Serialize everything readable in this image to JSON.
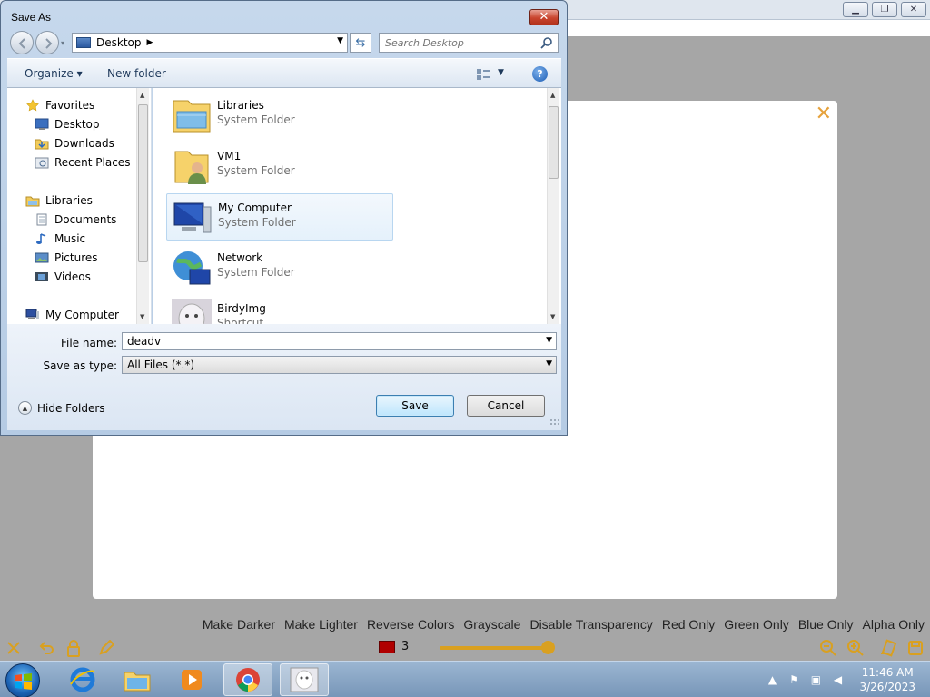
{
  "dialog": {
    "title": "Save As",
    "close_label": "✕",
    "address": "Desktop",
    "search_placeholder": "Search Desktop",
    "toolbar": {
      "organize": "Organize ▾",
      "new_folder": "New folder"
    },
    "nav": {
      "items": [
        {
          "label": "Favorites",
          "icon": "star-icon",
          "kind": "group"
        },
        {
          "label": "Desktop",
          "icon": "desktop-icon",
          "kind": "child"
        },
        {
          "label": "Downloads",
          "icon": "downloads-icon",
          "kind": "child"
        },
        {
          "label": "Recent Places",
          "icon": "recent-places-icon",
          "kind": "child"
        },
        {
          "label": "Libraries",
          "icon": "libraries-icon",
          "kind": "group"
        },
        {
          "label": "Documents",
          "icon": "documents-icon",
          "kind": "child"
        },
        {
          "label": "Music",
          "icon": "music-icon",
          "kind": "child"
        },
        {
          "label": "Pictures",
          "icon": "pictures-icon",
          "kind": "child"
        },
        {
          "label": "Videos",
          "icon": "videos-icon",
          "kind": "child"
        },
        {
          "label": "My Computer",
          "icon": "computer-icon",
          "kind": "group"
        }
      ]
    },
    "files": [
      {
        "name": "Libraries",
        "type": "System Folder",
        "icon": "libraries-folder-icon",
        "selected": false
      },
      {
        "name": "VM1",
        "type": "System Folder",
        "icon": "user-folder-icon",
        "selected": false
      },
      {
        "name": "My Computer",
        "type": "System Folder",
        "icon": "computer-icon",
        "selected": true
      },
      {
        "name": "Network",
        "type": "System Folder",
        "icon": "network-icon",
        "selected": false
      },
      {
        "name": "BirdyImg",
        "type": "Shortcut",
        "icon": "image-thumbnail-icon",
        "selected": false
      }
    ],
    "file_name_label": "File name:",
    "file_name_value": "deadv",
    "save_type_label": "Save as type:",
    "save_type_value": "All Files (*.*)",
    "hide_folders": "Hide Folders",
    "save_button": "Save",
    "cancel_button": "Cancel"
  },
  "app": {
    "canvas_close": "✕",
    "filters": [
      "Make Darker",
      "Make Lighter",
      "Reverse Colors",
      "Grayscale",
      "Disable Transparency",
      "Red Only",
      "Green Only",
      "Blue Only",
      "Alpha Only"
    ],
    "color_count": "3",
    "color_swatch": "#b00000",
    "brush_size_fraction": 1.0,
    "accent_color": "#d9a020"
  },
  "taskbar": {
    "apps": [
      "internet-explorer-icon",
      "file-explorer-icon",
      "media-player-icon",
      "chrome-icon",
      "image-app-icon"
    ],
    "time": "11:46 AM",
    "date": "3/26/2023"
  }
}
